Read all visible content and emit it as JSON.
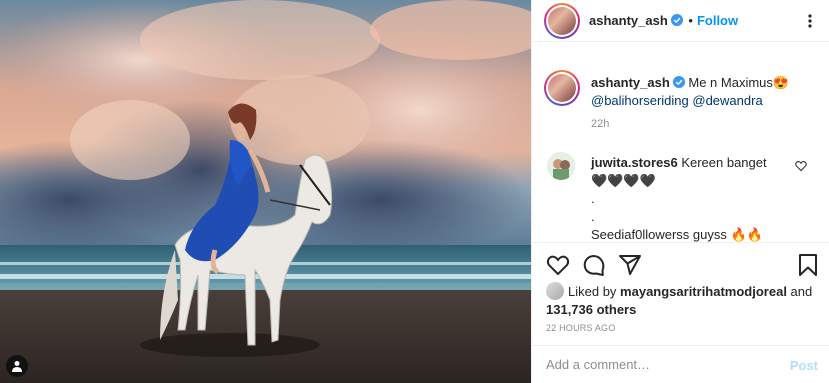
{
  "post": {
    "image_alt": "Woman in blue dress riding a white horse on a beach",
    "user_tag_icon": "person-icon"
  },
  "header": {
    "username": "ashanty_ash",
    "separator": "•",
    "follow_label": "Follow"
  },
  "caption": {
    "username": "ashanty_ash",
    "text": " Me n Maximus😍",
    "mention1": "@balihorseriding",
    "mention2": "@dewandra",
    "time": "22h"
  },
  "comments": [
    {
      "username": "juwita.stores6",
      "line1": " Kereen banget",
      "line2": "🖤🖤🖤🖤",
      "line3": ".",
      "line4": ".",
      "line5": "Seediaf0llowerss guyss 🔥🔥"
    }
  ],
  "likes": {
    "prefix": "Liked by ",
    "user": "mayangsaritrihatmodjoreal",
    "middle": " and",
    "count": "131,736 others"
  },
  "timestamp": "22 HOURS AGO",
  "add_comment": {
    "placeholder": "Add a comment…",
    "post_label": "Post"
  },
  "colors": {
    "accent": "#0095f6",
    "post_disabled": "#b2dffc",
    "mention": "#00376b"
  }
}
